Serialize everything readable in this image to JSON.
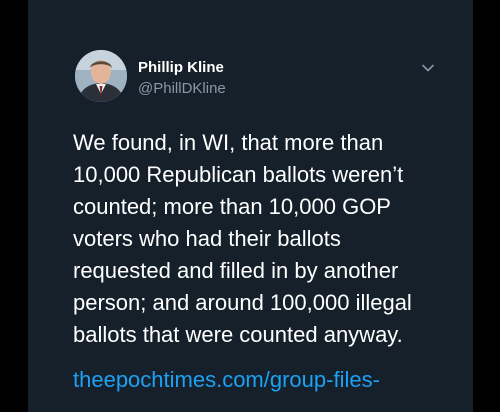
{
  "tweet": {
    "author": {
      "display_name": "Phillip Kline",
      "handle": "@PhillDKline",
      "avatar_icon": "profile-photo"
    },
    "menu_icon": "chevron-down-icon",
    "text_lines": [
      "We found, in WI, that more than",
      "10,000 Republican ballots weren’t",
      "counted; more than 10,000 GOP",
      "voters who had their ballots",
      "requested and filled in by another",
      "person; and around 100,000 illegal",
      "ballots that were counted anyway."
    ],
    "link": "theepochtimes.com/group-files-"
  },
  "colors": {
    "page_background": "#000000",
    "card_background": "#15202b",
    "primary_text": "#ffffff",
    "secondary_text": "#8899a6",
    "link": "#1da1f2"
  }
}
